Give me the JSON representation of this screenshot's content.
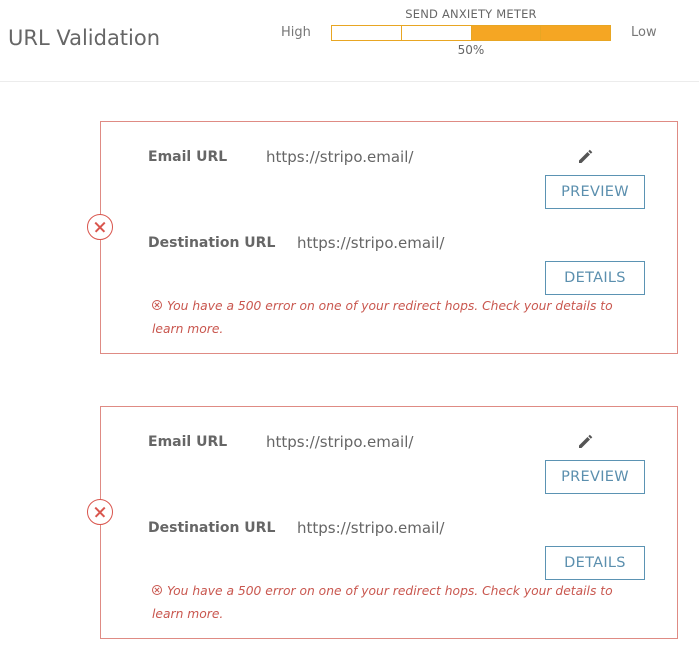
{
  "header": {
    "title": "URL Validation",
    "meter": {
      "title": "SEND ANXIETY METER",
      "high_label": "High",
      "low_label": "Low",
      "percent_text": "50%",
      "level_fraction": 0.5,
      "segments": 4,
      "fill_color": "#f5a623"
    }
  },
  "cards": [
    {
      "email_label": "Email URL",
      "email_url": "https://stripo.email/",
      "destination_label": "Destination URL",
      "destination_url": "https://stripo.email/",
      "preview_label": "PREVIEW",
      "details_label": "DETAILS",
      "error_text": "You have a 500 error on one of your redirect hops. Check your details to learn more.",
      "status_icon": "error-circle-x-icon",
      "edit_icon": "pencil-icon"
    },
    {
      "email_label": "Email URL",
      "email_url": "https://stripo.email/",
      "destination_label": "Destination URL",
      "destination_url": "https://stripo.email/",
      "preview_label": "PREVIEW",
      "details_label": "DETAILS",
      "error_text": "You have a 500 error on one of your redirect hops. Check your details to learn more.",
      "status_icon": "error-circle-x-icon",
      "edit_icon": "pencil-icon"
    }
  ],
  "colors": {
    "error": "#d9554d",
    "button": "#5b93b3",
    "meter": "#f5a623"
  }
}
